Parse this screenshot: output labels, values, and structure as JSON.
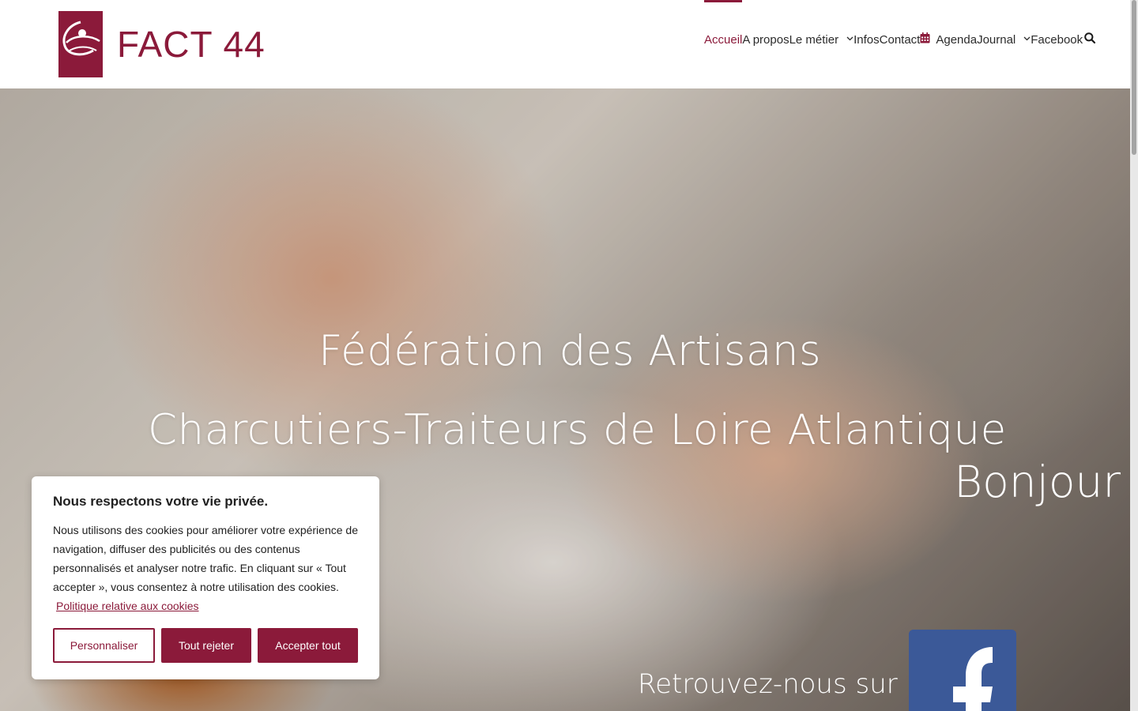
{
  "brand": {
    "name": "FACT 44",
    "color": "#8b1a3a"
  },
  "nav": {
    "items": [
      {
        "label": "Accueil",
        "active": true
      },
      {
        "label": "A propos"
      },
      {
        "label": "Le métier",
        "dropdown": true
      },
      {
        "label": "Infos"
      },
      {
        "label": "Contact"
      },
      {
        "label": "Agenda",
        "icon": "calendar-icon"
      },
      {
        "label": "Journal",
        "dropdown": true
      },
      {
        "label": "Facebook"
      }
    ],
    "search_icon": "search-icon"
  },
  "hero": {
    "title_line1": "Fédération des Artisans",
    "title_line2": "Charcutiers-Traiteurs de Loire Atlantique",
    "greeting": "Bonjour",
    "follow_text": "Retrouvez-nous sur",
    "social_icon": "facebook-icon",
    "social_color": "#3b5998"
  },
  "cookie_banner": {
    "title": "Nous respectons votre vie privée.",
    "text": "Nous utilisons des cookies pour améliorer votre expérience de navigation, diffuser des publicités ou des contenus personnalisés et analyser notre trafic. En cliquant sur « Tout accepter », vous consentez à notre utilisation des cookies.",
    "policy_link": "Politique relative aux cookies",
    "buttons": {
      "customize": "Personnaliser",
      "reject": "Tout rejeter",
      "accept": "Accepter tout"
    }
  }
}
